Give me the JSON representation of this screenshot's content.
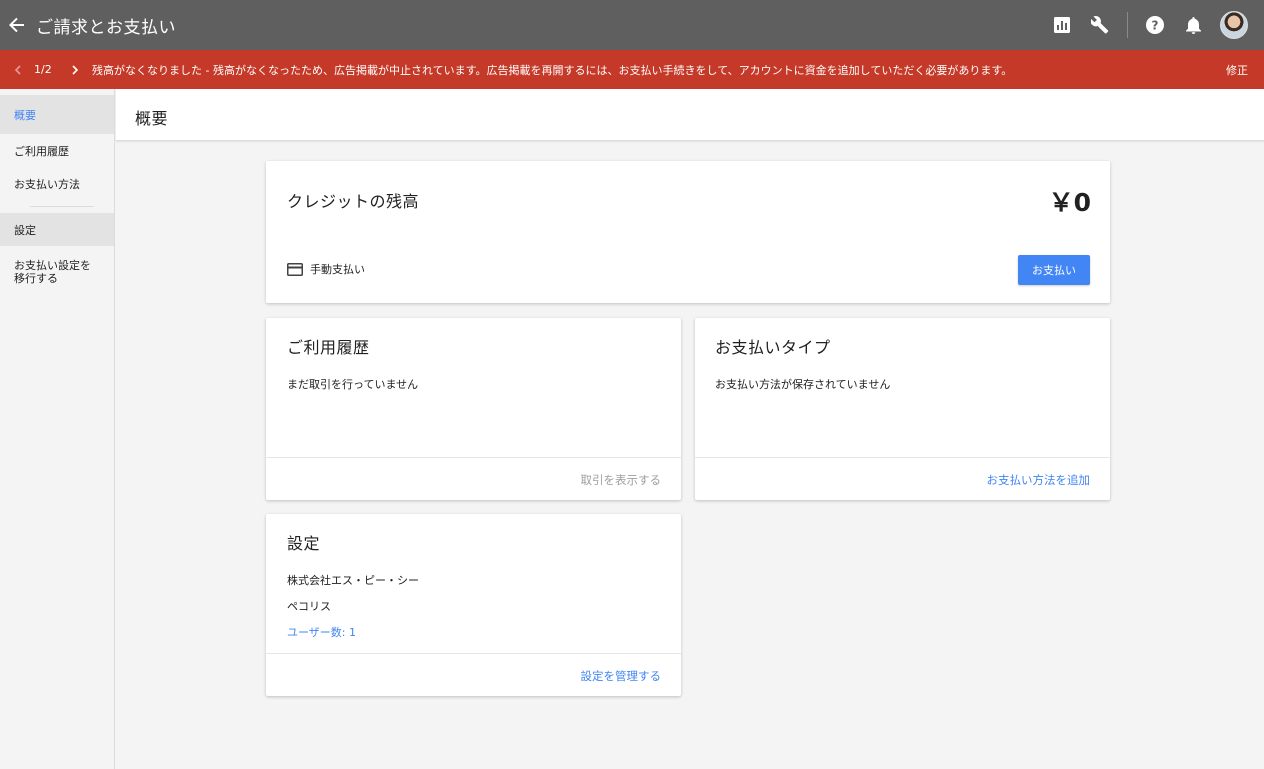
{
  "topbar": {
    "title": "ご請求とお支払い",
    "icons": [
      "back-arrow-icon",
      "bar-chart-icon",
      "wrench-icon",
      "help-icon",
      "bell-icon"
    ]
  },
  "alert": {
    "page": "1/2",
    "message": "残高がなくなりました - 残高がなくなったため、広告掲載が中止されています。広告掲載を再開するには、お支払い手続きをして、アカウントに資金を追加していただく必要があります。",
    "action": "修正"
  },
  "sidebar": {
    "items": [
      "概要",
      "ご利用履歴",
      "お支払い方法",
      "設定",
      "お支払い設定を移行する"
    ]
  },
  "header": {
    "title": "概要"
  },
  "credit": {
    "title": "クレジットの残高",
    "balance": "￥0",
    "method": "手動支払い",
    "pay_button": "お支払い"
  },
  "history": {
    "title": "ご利用履歴",
    "text": "まだ取引を行っていません",
    "link": "取引を表示する"
  },
  "payment_type": {
    "title": "お支払いタイプ",
    "text": "お支払い方法が保存されていません",
    "link": "お支払い方法を追加"
  },
  "settings": {
    "title": "設定",
    "company": "株式会社エス・ピー・シー",
    "name": "ペコリス",
    "users": "ユーザー数: 1",
    "link": "設定を管理する"
  },
  "colors": {
    "topbar": "#5f5f5f",
    "alert": "#c53929",
    "accent": "#4285f4"
  }
}
